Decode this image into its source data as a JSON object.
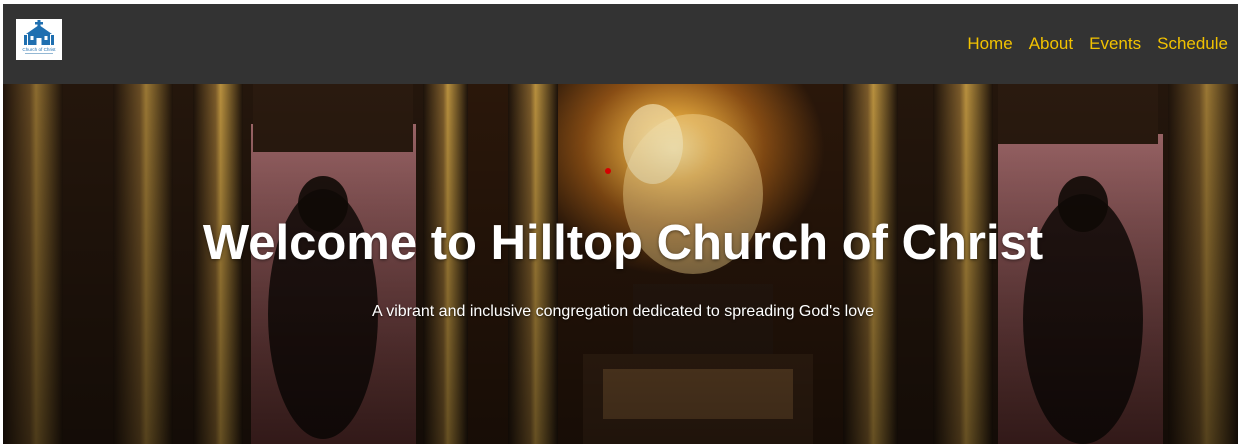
{
  "logo": {
    "text": "Church of Christ",
    "icon": "church-logo-icon"
  },
  "nav": {
    "items": [
      {
        "label": "Home"
      },
      {
        "label": "About"
      },
      {
        "label": "Events"
      },
      {
        "label": "Schedule"
      }
    ]
  },
  "hero": {
    "title": "Welcome to Hilltop Church of Christ",
    "subtitle": "A vibrant and inclusive congregation dedicated to spreading God's love"
  },
  "colors": {
    "navbar_bg": "#333333",
    "nav_link": "#f2c200",
    "logo_blue": "#1f6fb0",
    "hero_text": "#ffffff"
  }
}
